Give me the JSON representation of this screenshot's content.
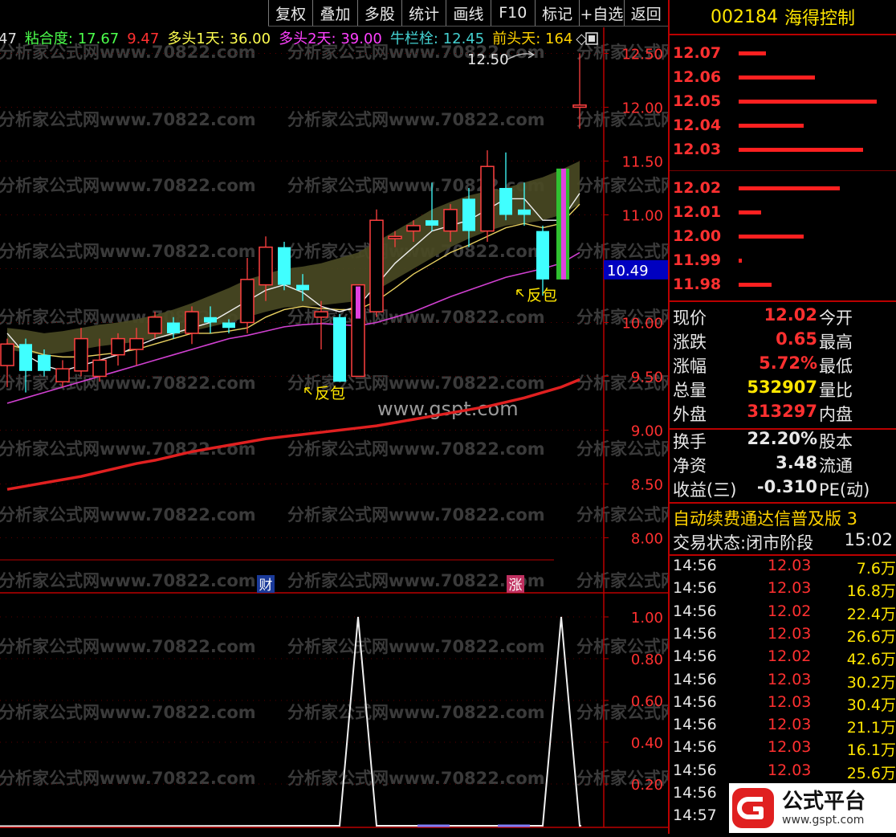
{
  "toolbar": {
    "buttons": [
      "复权",
      "叠加",
      "多股",
      "统计",
      "画线",
      "F10",
      "标记",
      "+自选",
      "返回"
    ]
  },
  "indicator_bar": {
    "items": [
      {
        "text": "47",
        "color": "#e0e0e0"
      },
      {
        "text": "粘合度: 17.67",
        "color": "#4cff4c"
      },
      {
        "text": "9.47",
        "color": "#ff3030"
      },
      {
        "text": "多头1天: 36.00",
        "color": "#ffff50"
      },
      {
        "text": "多头2天: 39.00",
        "color": "#ff40ff"
      },
      {
        "text": "牛栏栓: 12.45",
        "color": "#44d0d0"
      },
      {
        "text": "前头天: 164",
        "color": "#ffd200"
      }
    ],
    "diamond": "◇"
  },
  "watermarks": {
    "site": "分析家公式网www.70822.com",
    "gspt": "www.gspt.com"
  },
  "annotations": {
    "fanbao_label": "反包",
    "cai_badge": "财",
    "zhang_badge": "涨",
    "high_label": "12.50"
  },
  "chart_data": [
    {
      "type": "candlestick",
      "y_ticks": [
        "12.50",
        "12.00",
        "11.50",
        "11.00",
        "10.50",
        "10.00",
        "9.50",
        "9.00",
        "8.50",
        "8.00"
      ],
      "current_price": "10.49",
      "ylim": [
        7.85,
        12.7
      ],
      "candles": [
        {
          "o": 9.6,
          "c": 9.8,
          "h": 9.85,
          "l": 9.4
        },
        {
          "o": 9.8,
          "c": 9.55,
          "h": 9.85,
          "l": 9.35
        },
        {
          "o": 9.7,
          "c": 9.55,
          "h": 9.75,
          "l": 9.5
        },
        {
          "o": 9.45,
          "c": 9.57,
          "h": 9.65,
          "l": 9.4
        },
        {
          "o": 9.55,
          "c": 9.85,
          "h": 9.95,
          "l": 9.5
        },
        {
          "o": 9.5,
          "c": 9.65,
          "h": 9.85,
          "l": 9.45
        },
        {
          "o": 9.7,
          "c": 9.85,
          "h": 9.9,
          "l": 9.6
        },
        {
          "o": 9.75,
          "c": 9.85,
          "h": 9.95,
          "l": 9.6
        },
        {
          "o": 9.9,
          "c": 10.05,
          "h": 10.1,
          "l": 9.85
        },
        {
          "o": 10.0,
          "c": 9.9,
          "h": 10.05,
          "l": 9.85
        },
        {
          "o": 9.9,
          "c": 10.1,
          "h": 10.15,
          "l": 9.8
        },
        {
          "o": 10.05,
          "c": 10.0,
          "h": 10.15,
          "l": 9.9
        },
        {
          "o": 10.0,
          "c": 9.95,
          "h": 10.03,
          "l": 9.9
        },
        {
          "o": 10.0,
          "c": 10.4,
          "h": 10.6,
          "l": 9.9
        },
        {
          "o": 10.35,
          "c": 10.7,
          "h": 10.8,
          "l": 10.2
        },
        {
          "o": 10.7,
          "c": 10.35,
          "h": 10.75,
          "l": 10.3
        },
        {
          "o": 10.35,
          "c": 10.3,
          "h": 10.45,
          "l": 10.2
        },
        {
          "o": 10.05,
          "c": 10.1,
          "h": 10.2,
          "l": 9.75
        },
        {
          "o": 10.05,
          "c": 9.45,
          "h": 10.08,
          "l": 9.45
        },
        {
          "o": 9.5,
          "c": 10.35,
          "h": 10.35,
          "l": 9.5
        },
        {
          "o": 10.1,
          "c": 10.95,
          "h": 11.05,
          "l": 10.05
        },
        {
          "o": 10.78,
          "c": 10.8,
          "h": 10.85,
          "l": 10.7
        },
        {
          "o": 10.85,
          "c": 10.9,
          "h": 10.95,
          "l": 10.75
        },
        {
          "o": 10.95,
          "c": 10.9,
          "h": 11.3,
          "l": 10.85
        },
        {
          "o": 10.85,
          "c": 11.05,
          "h": 11.1,
          "l": 10.75
        },
        {
          "o": 11.15,
          "c": 10.85,
          "h": 11.25,
          "l": 10.7
        },
        {
          "o": 10.85,
          "c": 11.45,
          "h": 11.6,
          "l": 10.75
        },
        {
          "o": 11.25,
          "c": 11.0,
          "h": 11.58,
          "l": 10.95
        },
        {
          "o": 11.05,
          "c": 11.0,
          "h": 11.3,
          "l": 10.9
        },
        {
          "o": 10.85,
          "c": 10.4,
          "h": 10.9,
          "l": 10.25
        },
        {
          "o": 10.45,
          "c": 11.4,
          "h": 11.4,
          "l": 10.35
        },
        {
          "o": 12.0,
          "c": 12.02,
          "h": 12.5,
          "l": 11.8
        }
      ],
      "ma_white": [
        9.9,
        9.7,
        9.6,
        9.55,
        9.6,
        9.65,
        9.7,
        9.78,
        9.85,
        9.9,
        9.95,
        10.0,
        10.1,
        10.2,
        10.3,
        10.35,
        10.28,
        10.15,
        10.1,
        10.15,
        10.35,
        10.55,
        10.7,
        10.85,
        10.9,
        10.95,
        11.05,
        11.15,
        11.15,
        10.95,
        10.95,
        11.2
      ],
      "ma_yellow": [
        9.8,
        9.75,
        9.7,
        9.68,
        9.68,
        9.7,
        9.72,
        9.75,
        9.8,
        9.85,
        9.9,
        9.9,
        9.92,
        9.95,
        10.05,
        10.12,
        10.15,
        10.13,
        10.12,
        10.12,
        10.2,
        10.32,
        10.45,
        10.55,
        10.65,
        10.72,
        10.8,
        10.88,
        10.92,
        10.88,
        10.92,
        11.1
      ],
      "ma_magenta": [
        9.25,
        9.3,
        9.35,
        9.4,
        9.45,
        9.5,
        9.55,
        9.6,
        9.65,
        9.7,
        9.75,
        9.8,
        9.85,
        9.88,
        9.92,
        9.96,
        9.98,
        9.99,
        9.98,
        9.97,
        10.0,
        10.05,
        10.1,
        10.17,
        10.24,
        10.3,
        10.36,
        10.42,
        10.46,
        10.5,
        10.55,
        10.65
      ],
      "ma_red": [
        8.45,
        8.48,
        8.51,
        8.54,
        8.57,
        8.61,
        8.65,
        8.69,
        8.72,
        8.76,
        8.8,
        8.83,
        8.86,
        8.89,
        8.92,
        8.94,
        8.96,
        8.98,
        9.0,
        9.02,
        9.04,
        9.07,
        9.1,
        9.13,
        9.16,
        9.19,
        9.22,
        9.26,
        9.3,
        9.35,
        9.4,
        9.47
      ],
      "band_upper": [
        9.95,
        9.93,
        9.9,
        9.92,
        9.95,
        9.98,
        10.0,
        10.03,
        10.07,
        10.12,
        10.18,
        10.25,
        10.32,
        10.4,
        10.45,
        10.5,
        10.52,
        10.55,
        10.6,
        10.65,
        10.75,
        10.85,
        10.95,
        11.05,
        11.12,
        11.18,
        11.22,
        11.25,
        11.3,
        11.35,
        11.42,
        11.5
      ],
      "band_lower": [
        9.75,
        9.72,
        9.7,
        9.72,
        9.75,
        9.78,
        9.8,
        9.82,
        9.85,
        9.88,
        9.92,
        9.96,
        10.0,
        10.05,
        10.1,
        10.14,
        10.15,
        10.16,
        10.18,
        10.2,
        10.3,
        10.4,
        10.5,
        10.6,
        10.7,
        10.78,
        10.85,
        10.9,
        10.92,
        10.95,
        11.0,
        11.1
      ]
    },
    {
      "type": "line",
      "y_ticks": [
        "1.00",
        "0.80",
        "0.60",
        "0.40",
        "0.20"
      ],
      "ylim": [
        0,
        1.1
      ],
      "values": [
        0,
        0,
        0,
        0,
        0,
        0,
        0,
        0,
        0,
        0,
        0,
        0,
        0,
        0,
        0,
        0,
        0,
        0,
        0,
        1,
        0,
        0,
        0,
        0,
        0,
        0,
        0,
        0,
        0,
        0,
        1,
        0
      ]
    }
  ],
  "stock": {
    "code": "002184",
    "name": "海得控制"
  },
  "order_book": [
    {
      "price": "12.07",
      "size": 0.2
    },
    {
      "price": "12.06",
      "size": 0.55
    },
    {
      "price": "12.05",
      "size": 1.0
    },
    {
      "price": "12.04",
      "size": 0.47
    },
    {
      "price": "12.03",
      "size": 0.9
    },
    {
      "price": "12.02",
      "size": 0.73
    },
    {
      "price": "12.01",
      "size": 0.16
    },
    {
      "price": "12.00",
      "size": 0.47
    },
    {
      "price": "11.99",
      "size": 0.02
    },
    {
      "price": "11.98",
      "size": 0.24
    }
  ],
  "quote": [
    {
      "label": "现价",
      "value": "12.02",
      "color": "#ff3030",
      "label2": "今开"
    },
    {
      "label": "涨跌",
      "value": "0.65",
      "color": "#ff3030",
      "label2": "最高"
    },
    {
      "label": "涨幅",
      "value": "5.72%",
      "color": "#ff3030",
      "label2": "最低"
    },
    {
      "label": "总量",
      "value": "532907",
      "color": "#ffe600",
      "label2": "量比"
    },
    {
      "label": "外盘",
      "value": "313297",
      "color": "#ff3030",
      "label2": "内盘"
    },
    {
      "label": "换手",
      "value": "22.20%",
      "color": "#e8e8e8",
      "label2": "股本"
    },
    {
      "label": "净资",
      "value": "3.48",
      "color": "#e8e8e8",
      "label2": "流通"
    },
    {
      "label": "收益(三)",
      "value": "-0.310",
      "color": "#e8e8e8",
      "label2": "PE(动)"
    }
  ],
  "ticker_text": "自动续费通达信普及版 3",
  "trade_state": {
    "label": "交易状态:",
    "value": "闭市阶段",
    "time": "15:02"
  },
  "ticks": [
    {
      "time": "14:56",
      "price": "12.03",
      "vol": "7.6万"
    },
    {
      "time": "14:56",
      "price": "12.03",
      "vol": "16.8万"
    },
    {
      "time": "14:56",
      "price": "12.02",
      "vol": "22.4万"
    },
    {
      "time": "14:56",
      "price": "12.03",
      "vol": "26.6万"
    },
    {
      "time": "14:56",
      "price": "12.02",
      "vol": "42.6万"
    },
    {
      "time": "14:56",
      "price": "12.03",
      "vol": "30.2万"
    },
    {
      "time": "14:56",
      "price": "12.03",
      "vol": "30.4万"
    },
    {
      "time": "14:56",
      "price": "12.03",
      "vol": "21.1万"
    },
    {
      "time": "14:56",
      "price": "12.03",
      "vol": "16.1万"
    },
    {
      "time": "14:56",
      "price": "12.03",
      "vol": "25.6万"
    },
    {
      "time": "14:56",
      "price": "",
      "vol": ""
    },
    {
      "time": "14:57",
      "price": "",
      "vol": ""
    }
  ],
  "logo": {
    "text": "公式平台",
    "url": "www.gspt.com"
  }
}
